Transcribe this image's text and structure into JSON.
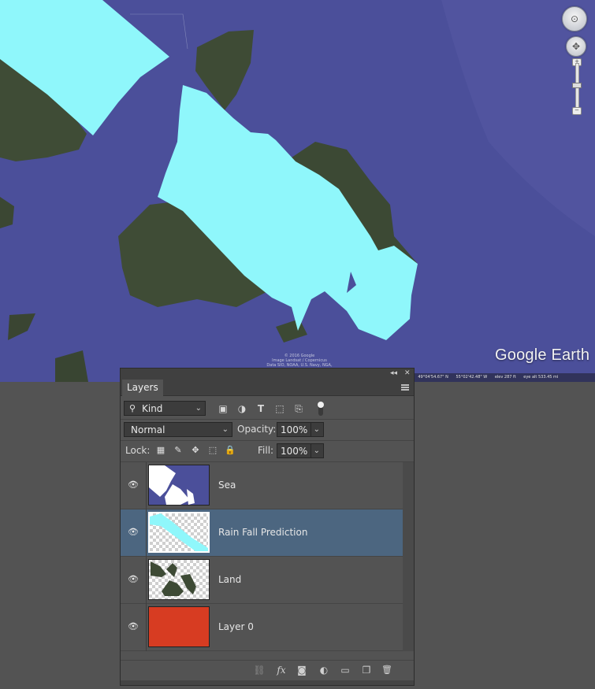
{
  "map": {
    "logo": "Google Earth",
    "copyright_lines": [
      "© 2016 Google",
      "Image Landsat / Copernicus",
      "Data SIO, NOAA, U.S. Navy, NGA, GEBCO"
    ],
    "status": {
      "imagery_date": "2015",
      "latitude": "49°04'54.67\" N",
      "longitude": "55°02'42.48\" W",
      "elevation": "elev  287 ft",
      "eye_altitude": "eye alt 533.45 mi"
    },
    "colors": {
      "sea": "#4b4f9a",
      "land": "#3d4a35",
      "rain_overlay": "#8ff7fb"
    },
    "zoom_level": 0.45
  },
  "panel": {
    "tab_label": "Layers",
    "collapse_glyph": "◂◂",
    "close_glyph": "✕",
    "filter": {
      "kind_label": "Kind",
      "search_glyph": "⚲",
      "chevron": "⌄"
    },
    "filter_icons": [
      "image-filter-icon",
      "adjustment-filter-icon",
      "type-filter-icon",
      "shape-filter-icon",
      "smart-object-filter-icon"
    ],
    "blend_mode": "Normal",
    "opacity_label": "Opacity:",
    "opacity_value": "100%",
    "lock_label": "Lock:",
    "fill_label": "Fill:",
    "fill_value": "100%",
    "layers": [
      {
        "name": "Sea",
        "visible": true,
        "selected": false
      },
      {
        "name": "Rain Fall Prediction",
        "visible": true,
        "selected": true
      },
      {
        "name": "Land",
        "visible": true,
        "selected": false
      },
      {
        "name": "Layer 0",
        "visible": true,
        "selected": false,
        "fill_color": "#d73c22"
      }
    ],
    "footer_icons": [
      "link-layers-icon",
      "fx-icon",
      "add-mask-icon",
      "adjustment-layer-icon",
      "new-group-icon",
      "new-layer-icon",
      "delete-layer-icon"
    ],
    "footer_glyphs": {
      "link": "⛓",
      "fx": "fx",
      "mask": "◙",
      "adjust": "◐",
      "group": "▭",
      "new": "❐",
      "delete": "🗑"
    },
    "eye_glyph": "👁"
  }
}
